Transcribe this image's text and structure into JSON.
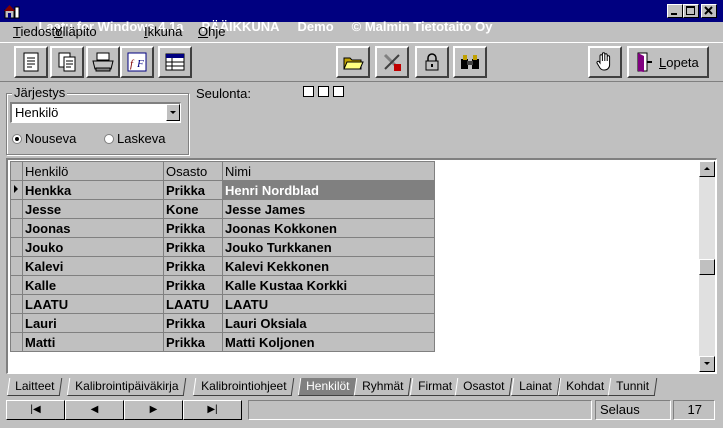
{
  "window": {
    "title_app": "Laatu for Windows 4.1a",
    "title_view": "PÄÄIKKUNA",
    "title_mode": "Demo",
    "title_copyright": "© Malmin Tietotaito Oy"
  },
  "menu": [
    {
      "label": "Tiedosto",
      "underline": "T"
    },
    {
      "label": "Ylläpito",
      "underline": "Y"
    },
    {
      "label": "Ikkuna",
      "underline": "I"
    },
    {
      "label": "Ohje",
      "underline": "O"
    }
  ],
  "toolbar": {
    "lopeta_label": "Lopeta",
    "icons": [
      "document-icon",
      "copy-icon",
      "printer-icon",
      "formula-icon",
      "table-icon",
      "folder-icon",
      "tools-icon",
      "lock-icon",
      "binoculars-icon",
      "hand-icon",
      "exit-door-icon"
    ]
  },
  "sort": {
    "group_label": "Järjestys",
    "selected": "Henkilö",
    "ascending_label": "Nouseva",
    "descending_label": "Laskeva",
    "ascending_selected": true
  },
  "filter": {
    "label": "Seulonta:",
    "checkboxes": [
      false,
      false,
      false
    ]
  },
  "grid": {
    "columns": [
      "Henkilö",
      "Osasto",
      "Nimi"
    ],
    "rows": [
      {
        "henkilo": "Henkka",
        "osasto": "Prikka",
        "nimi": "Henri Nordblad",
        "current": true
      },
      {
        "henkilo": "Jesse",
        "osasto": "Kone",
        "nimi": "Jesse James"
      },
      {
        "henkilo": "Joonas",
        "osasto": "Prikka",
        "nimi": "Joonas Kokkonen"
      },
      {
        "henkilo": "Jouko",
        "osasto": "Prikka",
        "nimi": "Jouko Turkkanen"
      },
      {
        "henkilo": "Kalevi",
        "osasto": "Prikka",
        "nimi": "Kalevi Kekkonen"
      },
      {
        "henkilo": "Kalle",
        "osasto": "Prikka",
        "nimi": "Kalle Kustaa Korkki"
      },
      {
        "henkilo": "LAATU",
        "osasto": "LAATU",
        "nimi": "LAATU"
      },
      {
        "henkilo": "Lauri",
        "osasto": "Prikka",
        "nimi": "Lauri Oksiala"
      },
      {
        "henkilo": "Matti",
        "osasto": "Prikka",
        "nimi": "Matti Koljonen"
      }
    ]
  },
  "tabs": [
    "Laitteet",
    "Kalibrointipäiväkirja",
    "Kalibrointiohjeet",
    "Henkilöt",
    "Ryhmät",
    "Firmat",
    "Osastot",
    "Lainat",
    "Kohdat",
    "Tunnit"
  ],
  "active_tab": "Henkilöt",
  "navigator": {
    "first": "|◀",
    "prev": "◀",
    "next": "▶",
    "last": "▶|"
  },
  "status": {
    "mode": "Selaus",
    "count": "17"
  }
}
